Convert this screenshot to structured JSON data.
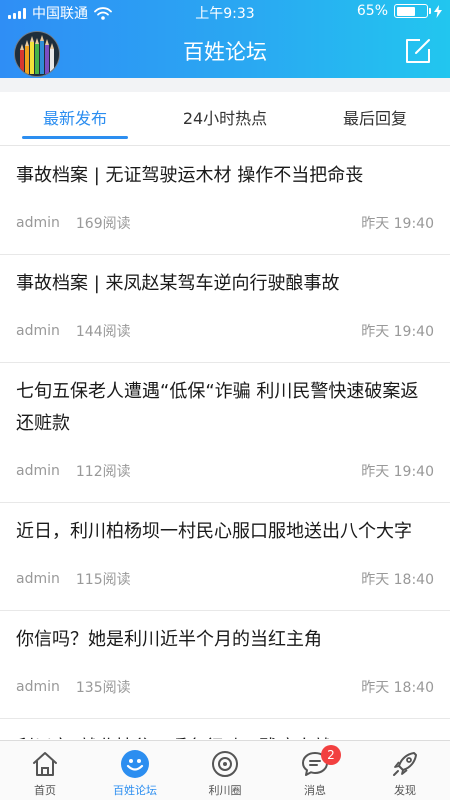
{
  "status_bar": {
    "carrier": "中国联通",
    "time": "上午9:33",
    "battery_text": "65%",
    "battery_level": 0.65
  },
  "header": {
    "title": "百姓论坛",
    "compose_icon": "compose-icon",
    "avatar_icon": "pencils-avatar"
  },
  "tabs": [
    {
      "label": "最新发布",
      "active": true
    },
    {
      "label": "24小时热点",
      "active": false
    },
    {
      "label": "最后回复",
      "active": false
    }
  ],
  "posts": [
    {
      "title": "事故档案 | 无证驾驶运木材 操作不当把命丧",
      "author": "admin",
      "reads": "169阅读",
      "time": "昨天 19:40"
    },
    {
      "title": "事故档案 | 来凤赵某驾车逆向行驶酿事故",
      "author": "admin",
      "reads": "144阅读",
      "time": "昨天 19:40"
    },
    {
      "title": "七旬五保老人遭遇“低保“诈骗 利川民警快速破案返还赃款",
      "author": "admin",
      "reads": "112阅读",
      "time": "昨天 19:40"
    },
    {
      "title": "近日，利川柏杨坝一村民心服口服地送出八个大字",
      "author": "admin",
      "reads": "115阅读",
      "time": "昨天 18:40"
    },
    {
      "title": "你信吗？她是利川近半个月的当红主角",
      "author": "admin",
      "reads": "135阅读",
      "time": "昨天 18:40"
    },
    {
      "title": "利川市“就业扶贫、暖冬行动、残疾人就",
      "author": "",
      "reads": "",
      "time": ""
    }
  ],
  "tabbar": [
    {
      "label": "首页",
      "icon": "home-icon",
      "active": false
    },
    {
      "label": "百姓论坛",
      "icon": "forum-icon",
      "active": true
    },
    {
      "label": "利川圈",
      "icon": "circle-icon",
      "active": false
    },
    {
      "label": "消息",
      "icon": "message-icon",
      "active": false,
      "badge": "2"
    },
    {
      "label": "发现",
      "icon": "rocket-icon",
      "active": false
    }
  ],
  "colors": {
    "accent": "#2c8ef0",
    "header_gradient_start": "#2f8ef5",
    "header_gradient_end": "#22c6ef",
    "badge": "#f24040"
  }
}
